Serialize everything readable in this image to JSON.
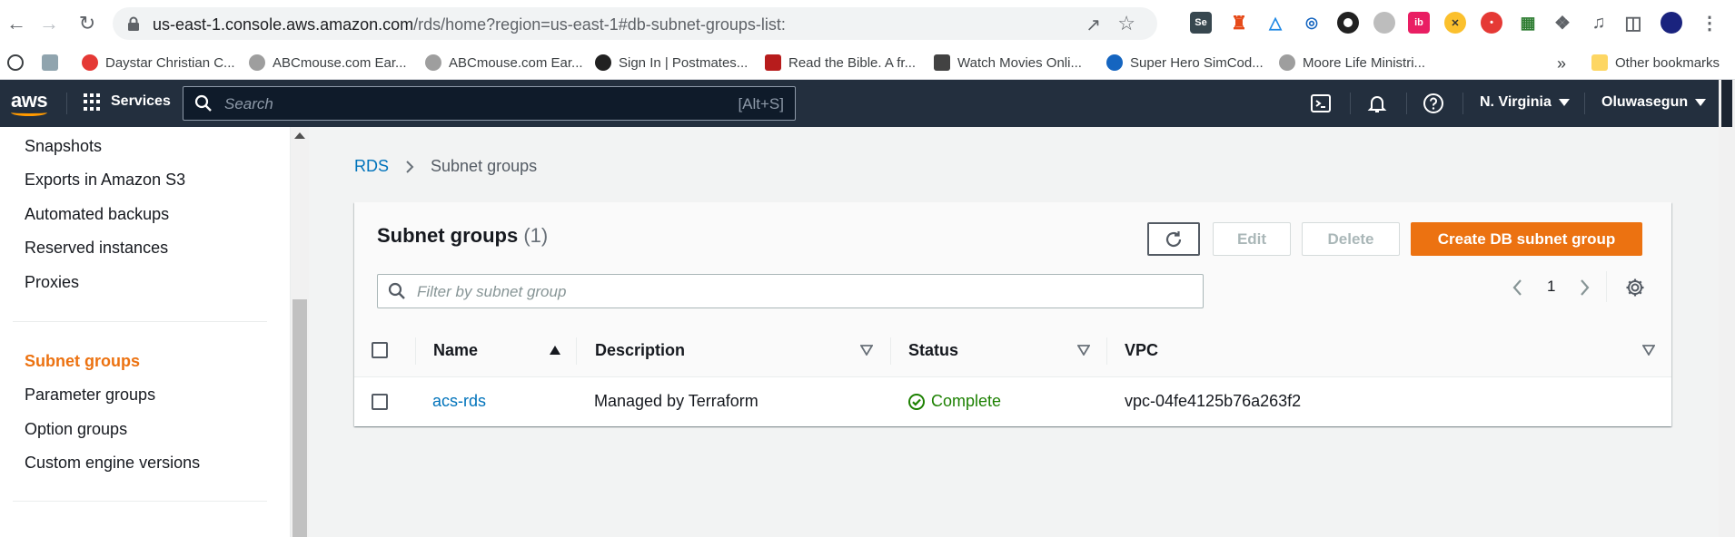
{
  "browser": {
    "url_host": "us-east-1.console.aws.amazon.com",
    "url_path": "/rds/home?region=us-east-1#db-subnet-groups-list:",
    "bookmarks": [
      {
        "label": "Daystar Christian C...",
        "color": "#e53935"
      },
      {
        "label": "ABCmouse.com Ear...",
        "color": "#9e9e9e"
      },
      {
        "label": "ABCmouse.com Ear...",
        "color": "#9e9e9e"
      },
      {
        "label": "Sign In | Postmates...",
        "color": "#212121"
      },
      {
        "label": "Read the Bible. A fr...",
        "color": "#b71c1c"
      },
      {
        "label": "Watch Movies Onli...",
        "color": "#424242"
      },
      {
        "label": "Super Hero SimCod...",
        "color": "#1565c0"
      },
      {
        "label": "Moore Life Ministri...",
        "color": "#9e9e9e"
      }
    ],
    "overflow": "»",
    "other_bookmarks": "Other bookmarks",
    "extensions": [
      "Se",
      "",
      "",
      "",
      "",
      "",
      "ib",
      "",
      "",
      ""
    ]
  },
  "aws_nav": {
    "logo": "aws",
    "services": "Services",
    "search_placeholder": "Search",
    "search_shortcut": "[Alt+S]",
    "region": "N. Virginia",
    "user": "Oluwasegun"
  },
  "sidebar": {
    "items_top": [
      "Snapshots",
      "Exports in Amazon S3",
      "Automated backups",
      "Reserved instances",
      "Proxies"
    ],
    "active": "Subnet groups",
    "items_bottom": [
      "Parameter groups",
      "Option groups",
      "Custom engine versions"
    ]
  },
  "breadcrumb": {
    "root": "RDS",
    "current": "Subnet groups"
  },
  "panel": {
    "title": "Subnet groups",
    "count": "(1)",
    "edit": "Edit",
    "delete": "Delete",
    "create": "Create DB subnet group",
    "filter_placeholder": "Filter by subnet group",
    "page": "1"
  },
  "table": {
    "columns": [
      "Name",
      "Description",
      "Status",
      "VPC"
    ],
    "rows": [
      {
        "name": "acs-rds",
        "description": "Managed by Terraform",
        "status": "Complete",
        "vpc": "vpc-04fe4125b76a263f2"
      }
    ]
  },
  "colors": {
    "aws_nav": "#232f3e",
    "accent": "#ec7211",
    "link": "#0073bb",
    "success": "#1d8102"
  }
}
